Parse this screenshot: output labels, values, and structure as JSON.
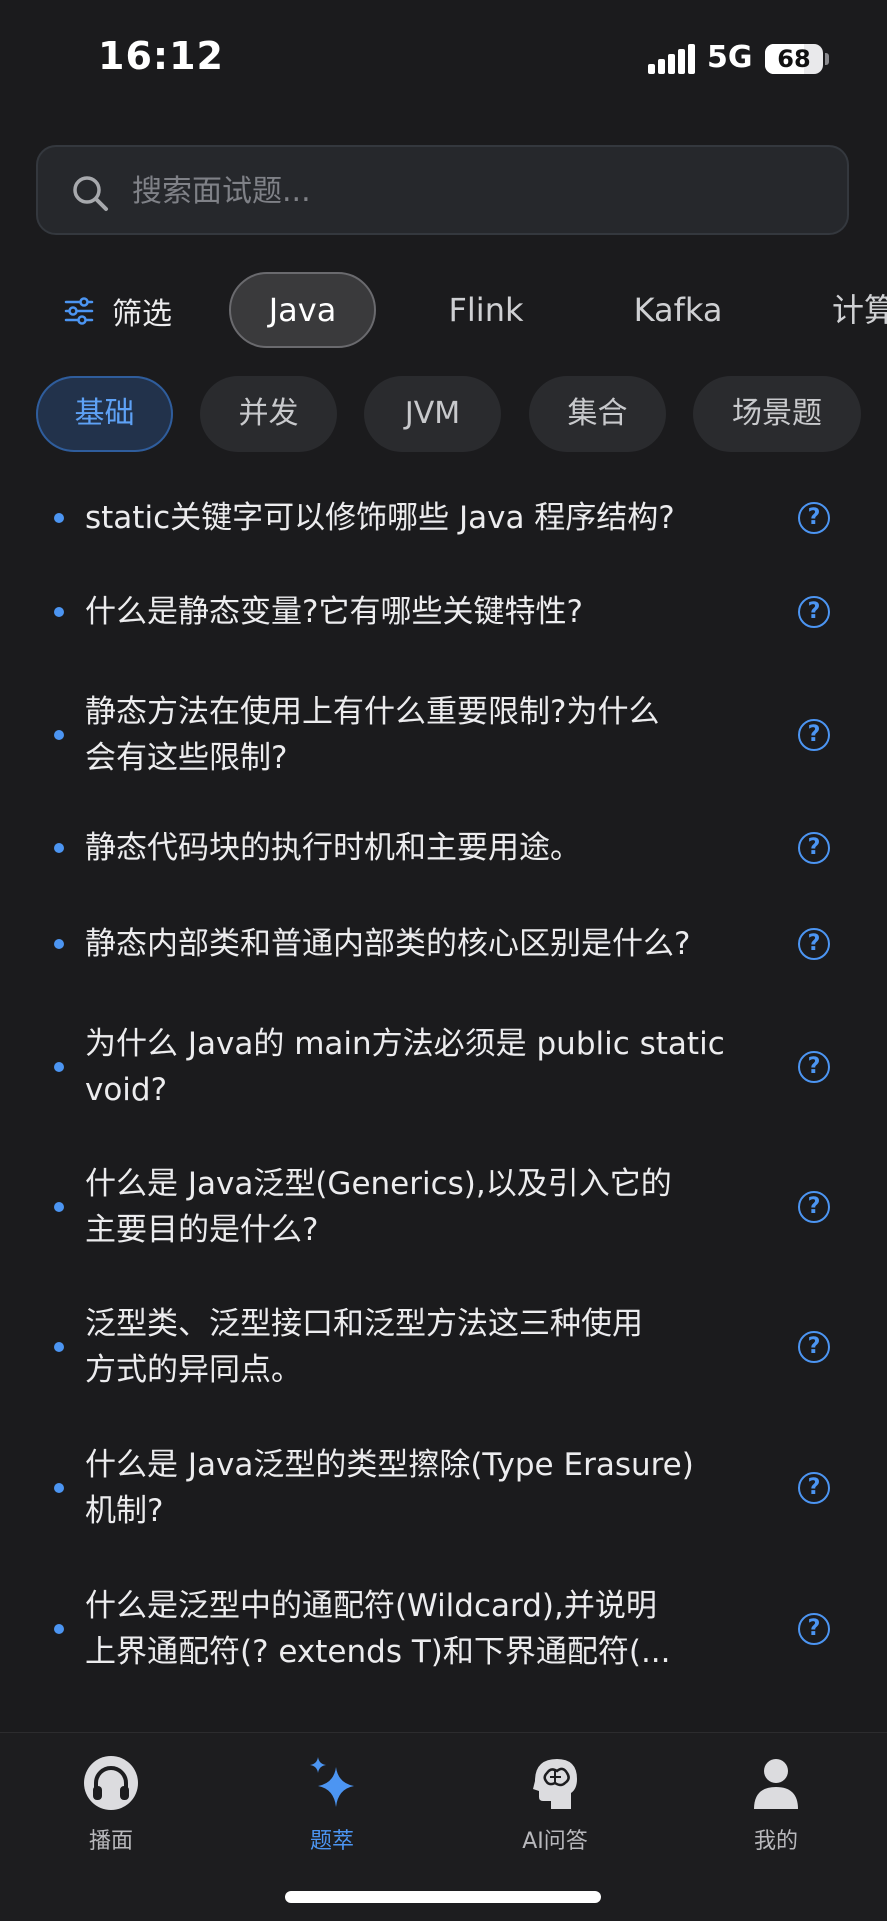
{
  "status": {
    "time": "16:12",
    "network": "5G",
    "battery": "68",
    "battery_level": 0.68
  },
  "search": {
    "placeholder": "搜索面试题..."
  },
  "filter": {
    "label": "筛选"
  },
  "categories": [
    "Java",
    "Flink",
    "Kafka",
    "计算"
  ],
  "active_category": "Java",
  "subcategories": [
    "基础",
    "并发",
    "JVM",
    "集合",
    "场景题"
  ],
  "active_subcategory": "基础",
  "questions": [
    {
      "line1": "static关键字可以修饰哪些 Java 程序结构?",
      "line2": ""
    },
    {
      "line1": "什么是静态变量?它有哪些关键特性?",
      "line2": ""
    },
    {
      "line1": "静态方法在使用上有什么重要限制?为什么",
      "line2": "会有这些限制?"
    },
    {
      "line1": "静态代码块的执行时机和主要用途。",
      "line2": ""
    },
    {
      "line1": "静态内部类和普通内部类的核心区别是什么?",
      "line2": ""
    },
    {
      "line1": "为什么 Java的 main方法必须是 public static",
      "line2": "void?"
    },
    {
      "line1": "什么是 Java泛型(Generics),以及引入它的",
      "line2": "主要目的是什么?"
    },
    {
      "line1": "泛型类、泛型接口和泛型方法这三种使用",
      "line2": "方式的异同点。"
    },
    {
      "line1": "什么是 Java泛型的类型擦除(Type Erasure)",
      "line2": "机制?"
    },
    {
      "line1": "什么是泛型中的通配符(Wildcard),并说明",
      "line2": "上界通配符(? extends T)和下界通配符(..."
    }
  ],
  "help_glyph": "?",
  "tabbar": {
    "items": [
      {
        "label": "播面",
        "icon": "headphones-icon"
      },
      {
        "label": "题萃",
        "icon": "sparkle-icon"
      },
      {
        "label": "AI问答",
        "icon": "ai-brain-icon"
      },
      {
        "label": "我的",
        "icon": "person-icon"
      }
    ],
    "active": "题萃"
  },
  "colors": {
    "accent": "#4c95f2",
    "background": "#1b1b1d",
    "chip": "#2a2b2e",
    "active_chip": "#22324b"
  }
}
